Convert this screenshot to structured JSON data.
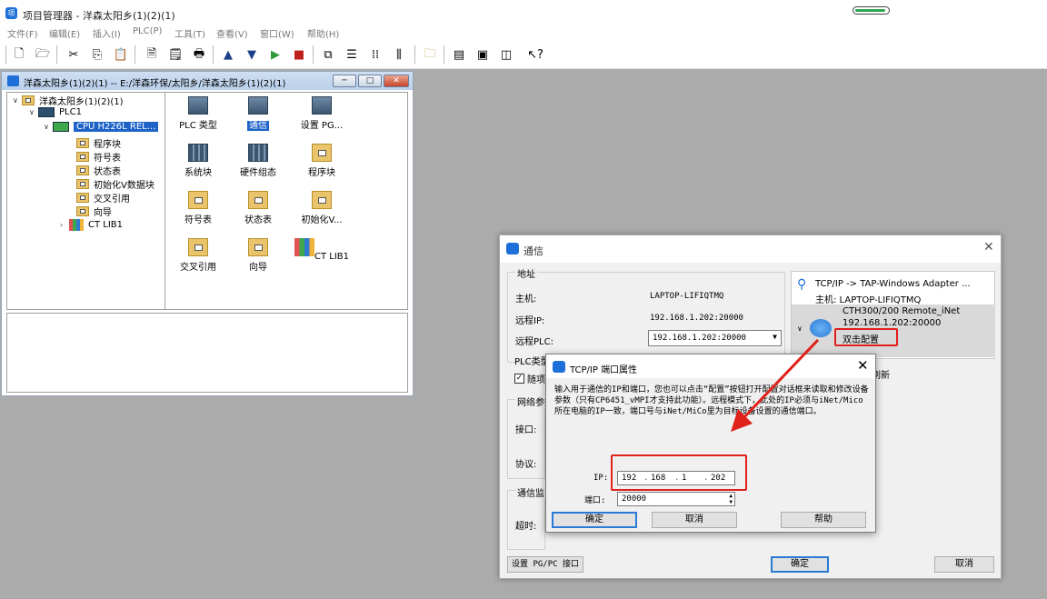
{
  "app": {
    "title": "项目管理器 - 洋森太阳乡(1)(2)(1)",
    "logo_text": "项"
  },
  "menu": [
    "文件(F)",
    "编辑(E)",
    "插入(I)",
    "PLC(P)",
    "工具(T)",
    "查看(V)",
    "窗口(W)",
    "帮助(H)"
  ],
  "toolbar_icons": [
    "new-icon",
    "open-icon",
    "cut-icon",
    "copy-icon",
    "paste-icon",
    "print-preview-icon",
    "properties-icon",
    "print-icon",
    "upload-icon",
    "download-icon",
    "run-icon",
    "stop-icon",
    "compare-icon",
    "list-icon",
    "grid-icon",
    "columns-icon",
    "folder-up-icon",
    "window-icon",
    "split-icon",
    "panel-icon",
    "help-icon"
  ],
  "project_window": {
    "title": "洋森太阳乡(1)(2)(1) -- E:/洋森环保/太阳乡/洋森太阳乡(1)(2)(1)",
    "tree": {
      "root": "洋森太阳乡(1)(2)(1)",
      "plc": "PLC1",
      "cpu": "CPU H226L REL...",
      "children": [
        "程序块",
        "符号表",
        "状态表",
        "初始化V数据块",
        "交叉引用",
        "向导"
      ],
      "lib": "CT LIB1"
    },
    "icons": [
      {
        "label": "PLC 类型"
      },
      {
        "label": "通信"
      },
      {
        "label": "设置 PG..."
      },
      {
        "label": "系统块"
      },
      {
        "label": "硬件组态"
      },
      {
        "label": "程序块"
      },
      {
        "label": "符号表"
      },
      {
        "label": "状态表"
      },
      {
        "label": "初始化V..."
      },
      {
        "label": "交叉引用"
      },
      {
        "label": "向导"
      },
      {
        "label": "CT LIB1"
      }
    ]
  },
  "comm_dialog": {
    "title": "通信",
    "address_group": "地址",
    "host_label": "主机:",
    "host_value": "LAPTOP-LIFIQTMQ",
    "remote_ip_label": "远程IP:",
    "remote_ip_value": "192.168.1.202:20000",
    "remote_plc_label": "远程PLC:",
    "remote_plc_value": "192.168.1.202:20000",
    "plc_type_label": "PLC类型",
    "checkbox_label": "随项",
    "network_label": "网络参数",
    "interface_label": "接口:",
    "protocol_label": "协议:",
    "monitor_label": "通信监",
    "timeout_label": "超时:",
    "set_pgpc_button": "设置 PG/PC 接口",
    "ok_button": "确定",
    "cancel_button": "取消",
    "right_panel": {
      "adapter": "TCP/IP -> TAP-Windows Adapter ...",
      "host": "主机: LAPTOP-LIFIQTMQ",
      "device": "CTH300/200 Remote_iNet",
      "device_ip": "192.168.1.202:20000",
      "double_click": "双击配置",
      "refresh": "刷新"
    }
  },
  "tcp_dialog": {
    "title": "TCP/IP 端口属性",
    "description": "输入用于通信的IP和端口，您也可以点击“配置”按钮打开配置对话框来读取和修改设备参数（只有CP6451_vMPI才支持此功能）。远程模式下，此处的IP必须与iNet/Mico所在电脑的IP一致，端口号与iNet/MiCo里为目标设备设置的通信端口。",
    "ip_label": "IP:",
    "ip_octets": [
      "192",
      "168",
      "1",
      "202"
    ],
    "port_label": "端口:",
    "port_value": "20000",
    "ok_button": "确定",
    "cancel_button": "取消",
    "help_button": "帮助"
  },
  "colors": {
    "highlight": "#e0201b",
    "selection": "#1e64c8",
    "accent": "#2a7ad6"
  }
}
